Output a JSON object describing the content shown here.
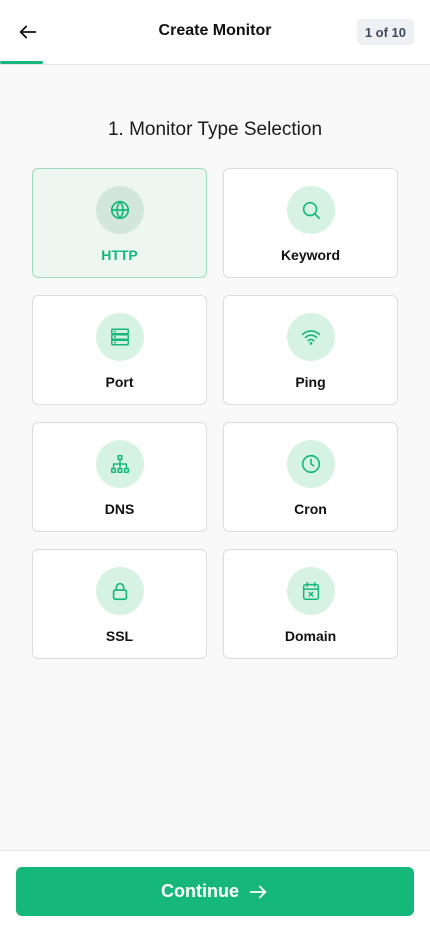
{
  "header": {
    "title": "Create Monitor",
    "step": "1 of 10",
    "progress_fraction": 0.1
  },
  "section": {
    "title": "1. Monitor Type Selection"
  },
  "monitor_types": [
    {
      "label": "HTTP",
      "icon": "globe-icon",
      "selected": true
    },
    {
      "label": "Keyword",
      "icon": "search-icon",
      "selected": false
    },
    {
      "label": "Port",
      "icon": "server-icon",
      "selected": false
    },
    {
      "label": "Ping",
      "icon": "wifi-icon",
      "selected": false
    },
    {
      "label": "DNS",
      "icon": "network-icon",
      "selected": false
    },
    {
      "label": "Cron",
      "icon": "clock-icon",
      "selected": false
    },
    {
      "label": "SSL",
      "icon": "lock-icon",
      "selected": false
    },
    {
      "label": "Domain",
      "icon": "calendar-x-icon",
      "selected": false
    }
  ],
  "footer": {
    "continue_label": "Continue"
  },
  "colors": {
    "accent": "#16b87a",
    "icon_bg": "#d6f2e3",
    "selected_bg": "#eef6f1"
  }
}
